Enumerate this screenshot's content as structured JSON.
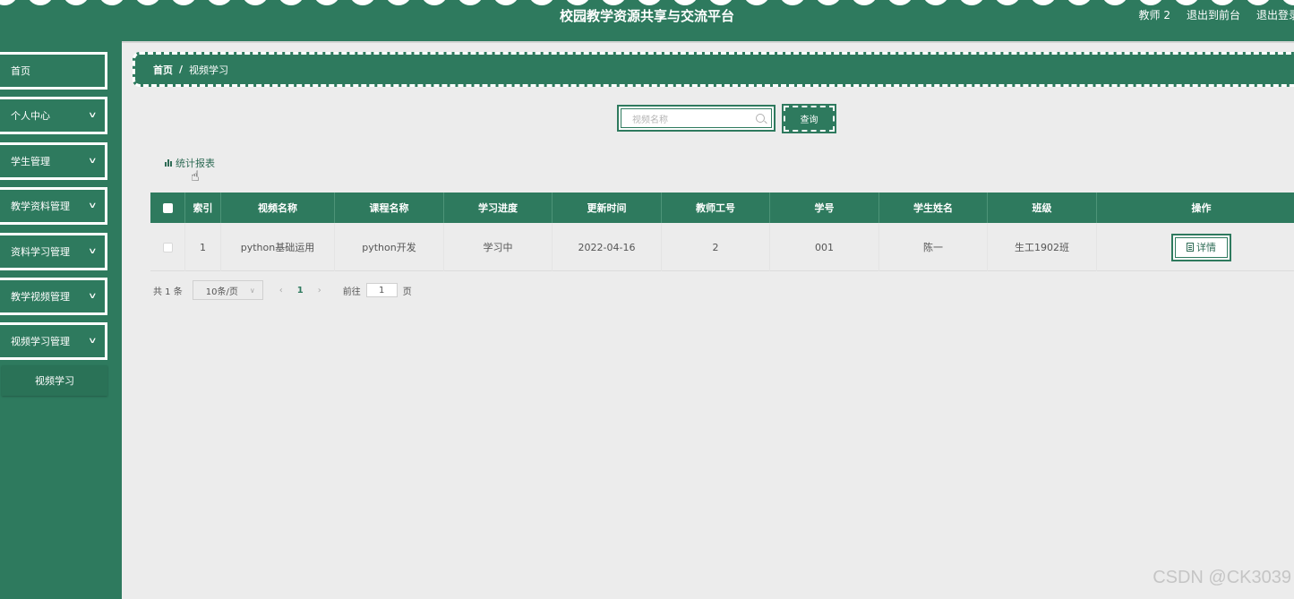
{
  "header": {
    "title": "校园教学资源共享与交流平台",
    "user": "教师 2",
    "front_link": "退出到前台",
    "logout_link": "退出登录"
  },
  "sidebar": {
    "items": [
      {
        "label": "首页",
        "has_arrow": false
      },
      {
        "label": "个人中心",
        "has_arrow": true
      },
      {
        "label": "学生管理",
        "has_arrow": true
      },
      {
        "label": "教学资料管理",
        "has_arrow": true
      },
      {
        "label": "资料学习管理",
        "has_arrow": true
      },
      {
        "label": "教学视频管理",
        "has_arrow": true
      },
      {
        "label": "视频学习管理",
        "has_arrow": true
      }
    ],
    "submenu_active": "视频学习"
  },
  "breadcrumb": {
    "home": "首页",
    "separator": "/",
    "current": "视频学习"
  },
  "search": {
    "placeholder": "视频名称",
    "button": "查询"
  },
  "stats_link": "统计报表",
  "table": {
    "headers": [
      "索引",
      "视频名称",
      "课程名称",
      "学习进度",
      "更新时间",
      "教师工号",
      "学号",
      "学生姓名",
      "班级",
      "操作"
    ],
    "rows": [
      {
        "index": "1",
        "video_name": "python基础运用",
        "course_name": "python开发",
        "progress": "学习中",
        "updated": "2022-04-16",
        "teacher_no": "2",
        "student_no": "001",
        "student_name": "陈一",
        "class": "生工1902班",
        "action": "详情"
      }
    ]
  },
  "pagination": {
    "total": "共 1 条",
    "page_size": "10条/页",
    "current_page": "1",
    "goto_label": "前往",
    "goto_value": "1",
    "page_suffix": "页",
    "prev": "‹",
    "next": "›"
  },
  "watermark": "CSDN @CK3039",
  "colors": {
    "primary": "#2e7a5e",
    "background": "#ececec"
  }
}
